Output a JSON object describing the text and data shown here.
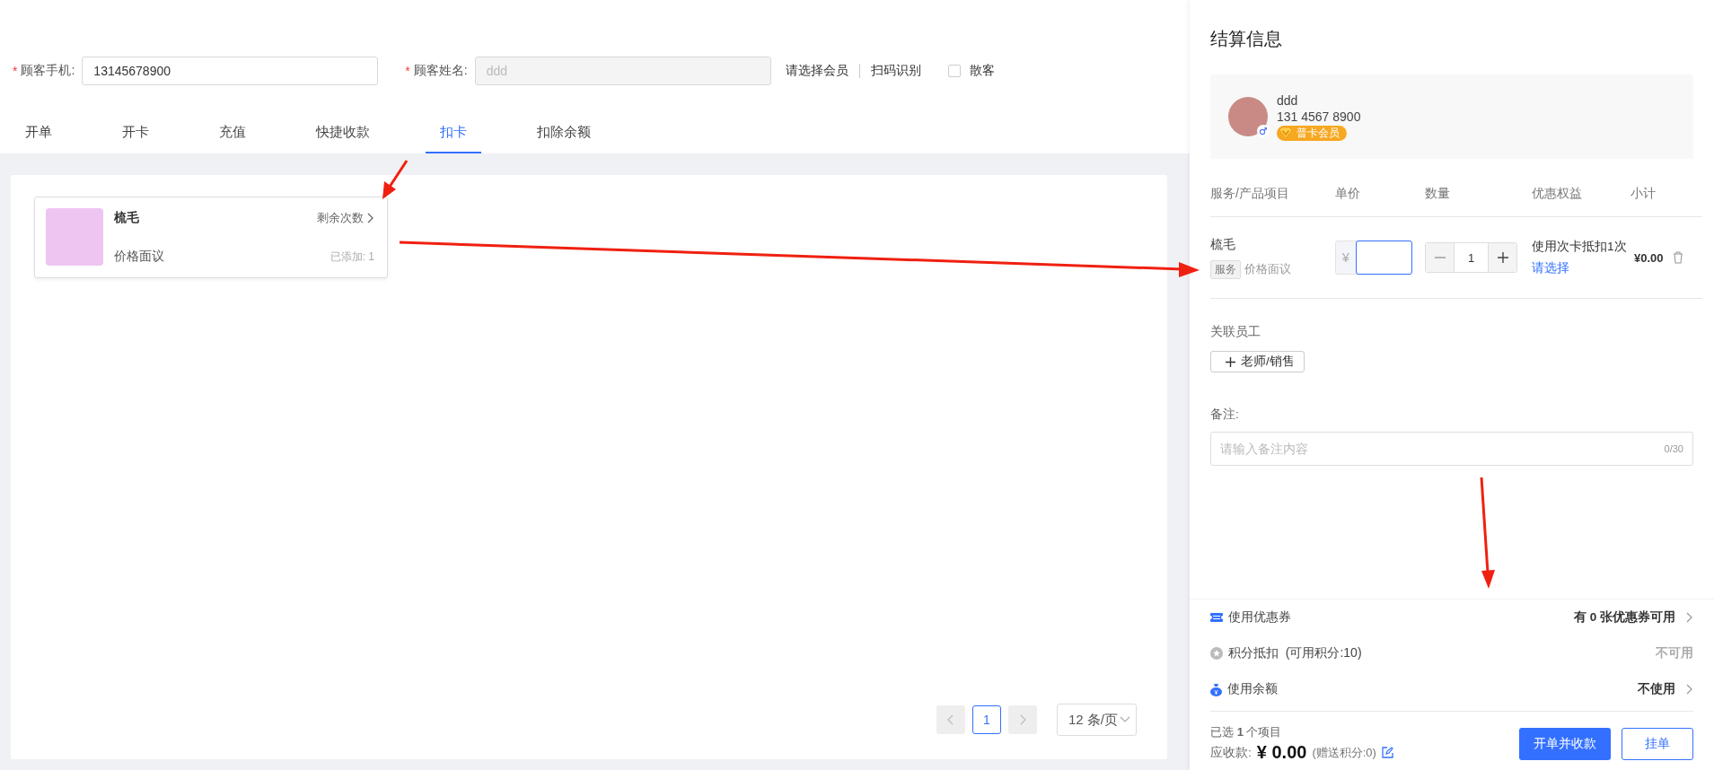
{
  "customer_form": {
    "phone": {
      "required_mark": "*",
      "label": "顾客手机:",
      "value": "13145678900"
    },
    "name": {
      "required_mark": "*",
      "label": "顾客姓名:",
      "value": "ddd",
      "disabled": true
    },
    "links": [
      "请选择会员",
      "扫码识别"
    ],
    "walk_in": {
      "label": "散客",
      "checked": false
    }
  },
  "tabs": [
    {
      "label": "开单",
      "selected": false
    },
    {
      "label": "开卡",
      "selected": false
    },
    {
      "label": "充值",
      "selected": false
    },
    {
      "label": "快捷收款",
      "selected": false
    },
    {
      "label": "扣卡",
      "selected": true
    },
    {
      "label": "扣除余额",
      "selected": false
    }
  ],
  "cards": [
    {
      "name": "梳毛",
      "remaining": "剩余次数",
      "price": "价格面议",
      "added": "已添加: 1"
    }
  ],
  "pagination": {
    "pages": [
      {
        "label": "1",
        "selected": true
      }
    ],
    "page_size": "12 条/页"
  },
  "checkout": {
    "title": "结算信息",
    "member": {
      "name": "ddd",
      "phone": "131 4567 8900",
      "level": "普卡会员"
    },
    "columns": [
      "服务/产品项目",
      "单价",
      "数量",
      "优惠权益",
      "小计"
    ],
    "items": [
      {
        "name": "梳毛",
        "tag": "服务",
        "price_note": "价格面议",
        "currency": "¥",
        "quantity": "1",
        "benefit": "使用次卡抵扣1次",
        "benefit_link": "请选择",
        "subtotal": "¥0.00"
      }
    ],
    "staff": {
      "label": "关联员工",
      "button": "老师/销售"
    },
    "remark": {
      "label": "备注:",
      "placeholder": "请输入备注内容",
      "counter": "0/30"
    },
    "options": [
      {
        "kind": "coupon",
        "label": "使用优惠券",
        "value": "有 **0** 张优惠券可用",
        "arrow": true,
        "disabled": false
      },
      {
        "kind": "points",
        "label": "积分抵扣  (可用积分:10)",
        "value": "不可用",
        "arrow": false,
        "disabled": true
      },
      {
        "kind": "balance",
        "label": "使用余额",
        "value": "不使用",
        "arrow": true,
        "disabled": false
      }
    ],
    "summary": {
      "selected": "已选 **1** 个项目",
      "due_label": "应收款:",
      "due": "¥ 0.00",
      "bonus": "(赠送积分:0)"
    },
    "buttons": [
      {
        "label": "开单并收款",
        "kind": "primary"
      },
      {
        "label": "挂单",
        "kind": "secondary"
      }
    ]
  }
}
